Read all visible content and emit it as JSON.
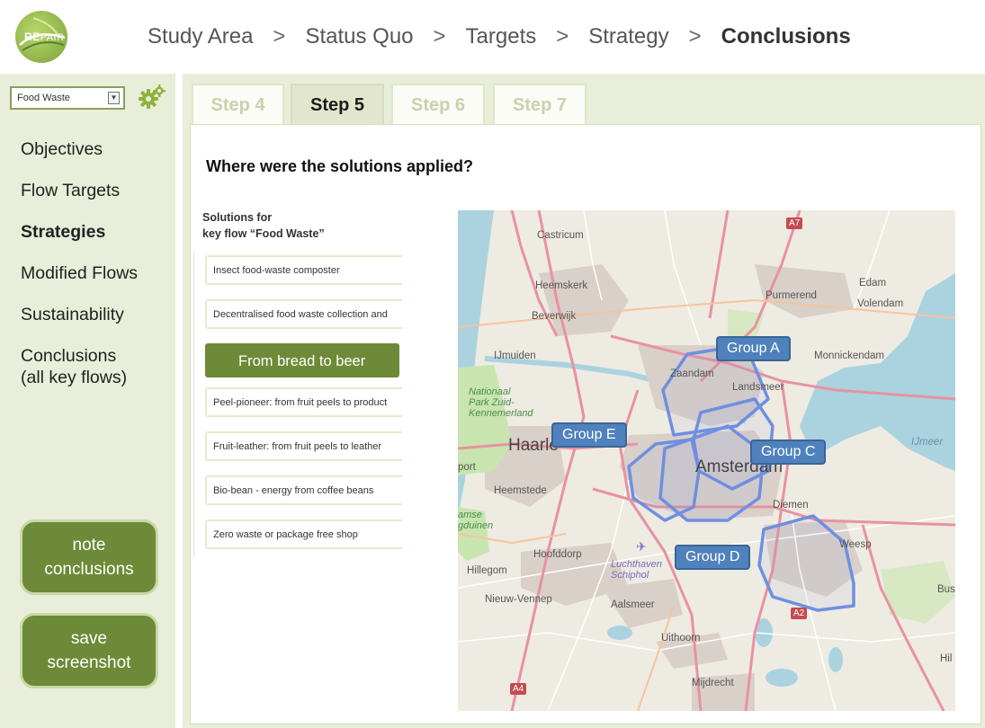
{
  "app": {
    "logo_text": "RE",
    "logo_text2": "PAIR"
  },
  "breadcrumb": [
    {
      "label": "Study Area"
    },
    {
      "label": "Status Quo"
    },
    {
      "label": "Targets"
    },
    {
      "label": "Strategy"
    },
    {
      "label": "Conclusions"
    }
  ],
  "breadcrumb_sep": ">",
  "sidebar": {
    "keyflow_select": "Food Waste",
    "menu": [
      {
        "label": "Objectives"
      },
      {
        "label": "Flow Targets"
      },
      {
        "label": "Strategies"
      },
      {
        "label": "Modified Flows"
      },
      {
        "label": "Sustainability"
      },
      {
        "label": "Conclusions",
        "label2": "(all key flows)"
      }
    ],
    "note_button": {
      "line1": "note",
      "line2": "conclusions"
    },
    "save_button": {
      "line1": "save",
      "line2": "screenshot"
    }
  },
  "tabs": [
    {
      "label": "Step 4"
    },
    {
      "label": "Step 5"
    },
    {
      "label": "Step 6"
    },
    {
      "label": "Step 7"
    }
  ],
  "main": {
    "question": "Where were the solutions applied?",
    "solutions_title_line1": "Solutions for",
    "solutions_title_line2": "key flow “Food Waste”",
    "solutions": [
      {
        "label": "Insect food-waste composter"
      },
      {
        "label": "Decentralised food waste collection and"
      },
      {
        "label": "From bread to beer"
      },
      {
        "label": "Peel-pioneer: from fruit peels to product"
      },
      {
        "label": "Fruit-leather: from fruit peels to leather"
      },
      {
        "label": "Bio-bean - energy from coffee beans"
      },
      {
        "label": "Zero waste or package free shop"
      }
    ]
  },
  "map": {
    "places": {
      "castricum": "Castricum",
      "heemskerk": "Heemskerk",
      "beverwijk": "Beverwijk",
      "ijmuiden": "IJmuiden",
      "purmerend": "Purmerend",
      "edam": "Edam",
      "volendam": "Volendam",
      "monnickendam": "Monnickendam",
      "zaandam": "Zaandam",
      "landsmeer": "Landsmeer",
      "park1": "Nationaal",
      "park2": "Park Zuid-",
      "park3": "Kennemerland",
      "haarlem": "Haarle",
      "port": "port",
      "amsterdam": "Amsterdam",
      "heemstede": "Heemstede",
      "amse": "amse",
      "duinen": "gduinen",
      "diemen": "Diemen",
      "weesp": "Weesp",
      "ijmeer": "IJmeer",
      "hoofddorp": "Hoofddorp",
      "schiphol1": "Luchthaven",
      "schiphol2": "Schiphol",
      "hillegom": "Hillegom",
      "nieuw_vennep": "Nieuw-Vennep",
      "aalsmeer": "Aalsmeer",
      "bus": "Bus",
      "uithoorn": "Uithoorn",
      "hil": "Hil",
      "mijdrecht": "Mijdrecht"
    },
    "road_signs": {
      "a7": "A7",
      "a2": "A2",
      "a4": "A4"
    },
    "groups": {
      "a": "Group A",
      "c": "Group C",
      "d": "Group D",
      "e": "Group E"
    },
    "colors": {
      "water": "#aad3df",
      "land": "#eeebe2",
      "urban": "#d9d0c9",
      "park": "#c8e5b0",
      "highway": "#e892a2",
      "group_outline": "#6f8fe0",
      "group_label": "#4f81bd"
    }
  },
  "colors": {
    "accent_green": "#6c8a37",
    "panel_bg": "#e8eed9"
  }
}
